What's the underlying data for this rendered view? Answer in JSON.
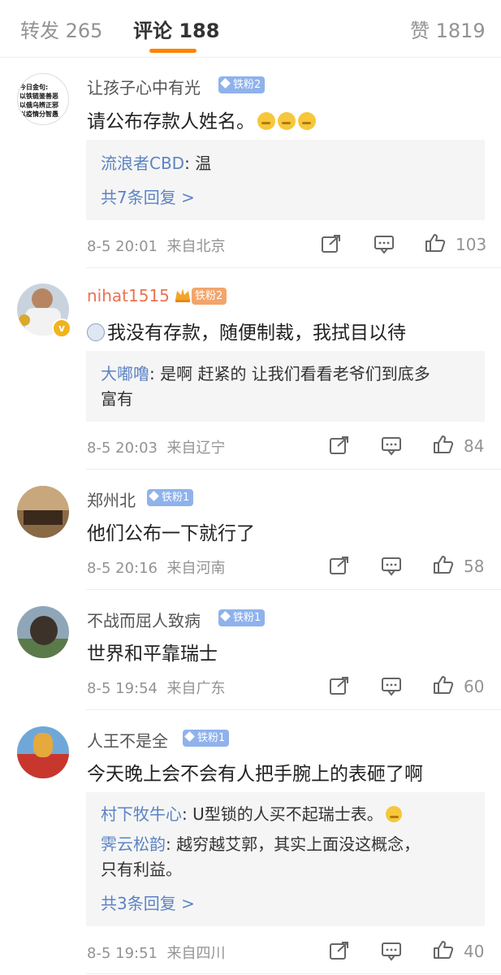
{
  "tabs": {
    "repost": "转发 265",
    "comments": "评论 188",
    "likes": "赞 1819"
  },
  "comments": [
    {
      "user": "让孩子心中有光",
      "badge": "铁粉2",
      "avatar_text": [
        "今日金句:",
        "以铁链鉴善恶",
        "以俄乌辨正邪",
        "以疫情分智愚"
      ],
      "text": "请公布存款人姓名。",
      "replies": [
        {
          "user": "流浪者CBD",
          "text": ": 温"
        }
      ],
      "more_replies": "共7条回复 >",
      "time": "8-5 20:01",
      "location": "来自北京",
      "likes": "103"
    },
    {
      "user": "nihat1515",
      "badge": "铁粉2",
      "text": "我没有存款，随便制裁，我拭目以待",
      "replies": [
        {
          "user": "大嘟噜",
          "text": ": 是啊 赶紧的 让我们看看老爷们到底多",
          "text2": "富有"
        }
      ],
      "time": "8-5 20:03",
      "location": "来自辽宁",
      "likes": "84"
    },
    {
      "user": "郑州北",
      "badge": "铁粉1",
      "text": "他们公布一下就行了",
      "time": "8-5 20:16",
      "location": "来自河南",
      "likes": "58"
    },
    {
      "user": "不战而屈人致病",
      "badge": "铁粉1",
      "text": "世界和平靠瑞士",
      "time": "8-5 19:54",
      "location": "来自广东",
      "likes": "60"
    },
    {
      "user": "人王不是全",
      "badge": "铁粉1",
      "text": "今天晚上会不会有人把手腕上的表砸了啊",
      "replies": [
        {
          "user": "村下牧牛心",
          "text": ": U型锁的人买不起瑞士表。"
        },
        {
          "user": "霁云松韵",
          "text": ": 越穷越艾郭，其实上面没这概念，",
          "text2": "只有利益。"
        }
      ],
      "more_replies": "共3条回复 >",
      "time": "8-5 19:51",
      "location": "来自四川",
      "likes": "40"
    }
  ],
  "colors": {
    "accent": "#ff8200",
    "link": "#5b84c4",
    "badge": "#8fb2ec",
    "vip_name": "#eb7350"
  }
}
